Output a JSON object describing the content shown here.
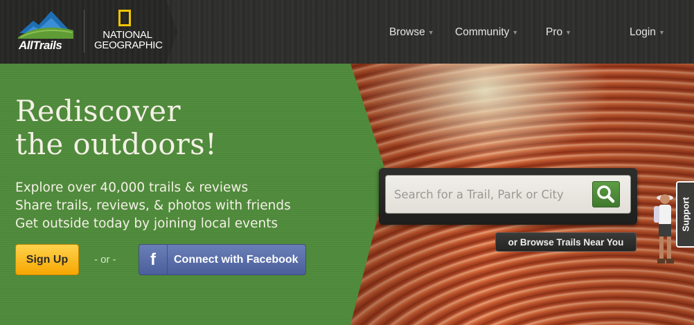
{
  "header": {
    "logo_text": "AllTrails",
    "partner_logo_text": "NATIONAL GEOGRAPHIC",
    "nav": [
      "Browse",
      "Community",
      "Pro"
    ],
    "login": "Login",
    "caret_icon": "chevron-down-icon"
  },
  "hero": {
    "headline_line1": "Rediscover",
    "headline_line2": "the outdoors!",
    "bullets": [
      "Explore over 40,000 trails & reviews",
      "Share trails, reviews, & photos with friends",
      "Get outside today by joining local events"
    ],
    "signup_label": "Sign Up",
    "or_text": "- or -",
    "facebook_icon_glyph": "f",
    "facebook_label": "Connect with Facebook"
  },
  "search": {
    "placeholder": "Search for a Trail, Park or City",
    "button_icon": "search-icon",
    "near_label": "or Browse Trails Near You"
  },
  "support_tab": "Support",
  "colors": {
    "green_panel": "#4f8a3a",
    "signup_button": "#f6a600",
    "facebook_button": "#4b5f9c",
    "natgeo_yellow": "#f2c500"
  }
}
